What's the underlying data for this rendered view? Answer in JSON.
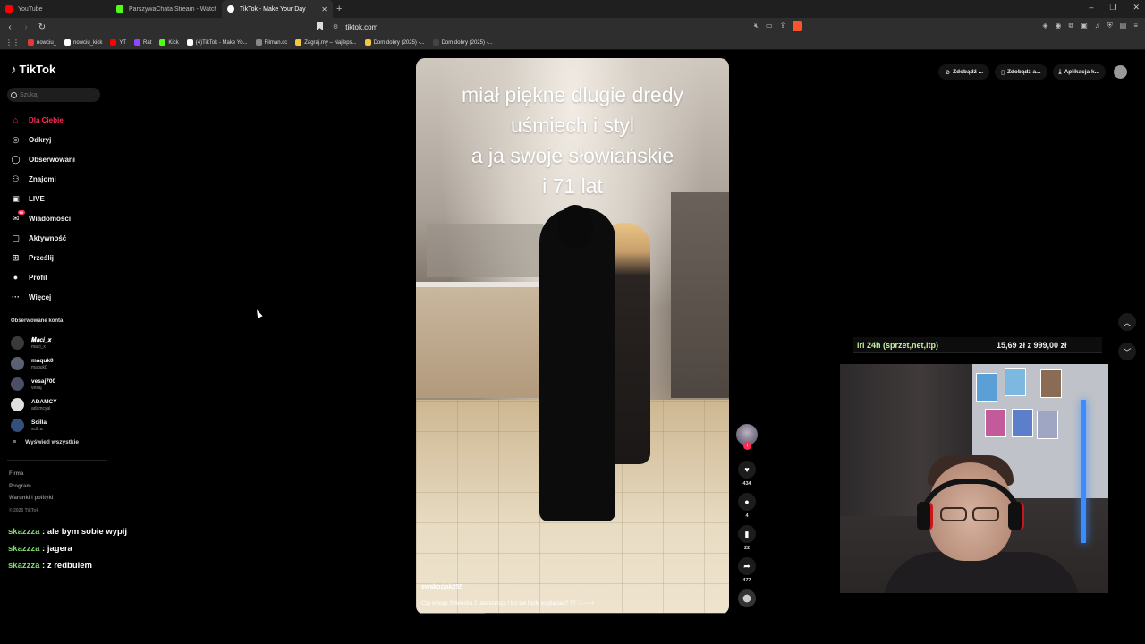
{
  "browser": {
    "tabs": [
      {
        "title": "YouTube",
        "color": "#ff0000",
        "active": false
      },
      {
        "title": "ParszywaChata Stream - Watch Live ...",
        "color": "#53fc18",
        "active": false
      },
      {
        "title": "TikTok - Make Your Day",
        "color": "#ffffff",
        "active": true
      }
    ],
    "url": "tiktok.com",
    "bookmarks": [
      {
        "label": "nowciu_",
        "color": "#e53935"
      },
      {
        "label": "nowciu_kick",
        "color": "#ffffff"
      },
      {
        "label": "YT",
        "color": "#ff0000"
      },
      {
        "label": "Rat",
        "color": "#9146ff"
      },
      {
        "label": "Kick",
        "color": "#53fc18"
      },
      {
        "label": "(4)TikTok - Make Yo...",
        "color": "#ffffff"
      },
      {
        "label": "Filman.cc",
        "color": "#888888"
      },
      {
        "label": "Zagraj.my – Najleps...",
        "color": "#f5c542"
      },
      {
        "label": "Dom dobry (2025) -...",
        "color": "#f5c542"
      },
      {
        "label": "Dom dobry (2025) -...",
        "color": "#444444"
      }
    ]
  },
  "tiktok": {
    "logo": "TikTok",
    "search_placeholder": "Szukaj",
    "nav": [
      {
        "label": "Dla Ciebie",
        "icon": "home-icon",
        "active": true
      },
      {
        "label": "Odkryj",
        "icon": "compass-icon"
      },
      {
        "label": "Obserwowani",
        "icon": "following-icon"
      },
      {
        "label": "Znajomi",
        "icon": "friends-icon"
      },
      {
        "label": "LIVE",
        "icon": "live-icon"
      },
      {
        "label": "Wiadomości",
        "icon": "messages-icon",
        "badge": "99"
      },
      {
        "label": "Aktywność",
        "icon": "activity-icon"
      },
      {
        "label": "Prześlij",
        "icon": "upload-icon"
      },
      {
        "label": "Profil",
        "icon": "profile-icon"
      },
      {
        "label": "Więcej",
        "icon": "more-icon"
      }
    ],
    "followed_heading": "Obserwowane konta",
    "followed": [
      {
        "name": "𝑴𝒂𝒄𝒊_𝒙",
        "handle": "maci_x",
        "avatar_color": "#3a3a3a"
      },
      {
        "name": "maquk0",
        "handle": "maquk0",
        "avatar_color": "#5b6072"
      },
      {
        "name": "vesaj700",
        "handle": "vesaj",
        "avatar_color": "#4a4e66"
      },
      {
        "name": "ADAMCY",
        "handle": "adamcyal",
        "avatar_color": "#e0e0e0"
      },
      {
        "name": "Scilla",
        "handle": "scill.a",
        "avatar_color": "#33507a"
      }
    ],
    "see_all": "Wyświetl wszystkie",
    "footer": [
      "Firma",
      "Program",
      "Warunki i polityki"
    ],
    "copyright": "© 2026 TikTok",
    "top_buttons": [
      "Zdobądź ...",
      "Zdobądź a...",
      "Aplikacja k..."
    ],
    "video": {
      "caption": [
        "miał piękne dlugie dredy",
        "uśmiech i styl",
        "a ja swoje słowiańskie",
        "i 71 lat"
      ],
      "author": "ewakozjak255",
      "description": "Czy w tego Sylwestra 2 lata starsza ! też tak będę wyglądała? ?? ♡--~-✧",
      "progress": 0.22
    },
    "actions": {
      "likes": "434",
      "comments": "4",
      "saves": "22",
      "shares": "477"
    }
  },
  "stream": {
    "donation_goal_label": "irl 24h (sprzet,net,itp)",
    "donation_goal_amount": "15,69 zł  z  999,00 zł",
    "chat": [
      {
        "user": "skazzza",
        "msg": "ale bym sobie wypij"
      },
      {
        "user": "skazzza",
        "msg": "jagera"
      },
      {
        "user": "skazzza",
        "msg": "z redbulem"
      }
    ]
  }
}
